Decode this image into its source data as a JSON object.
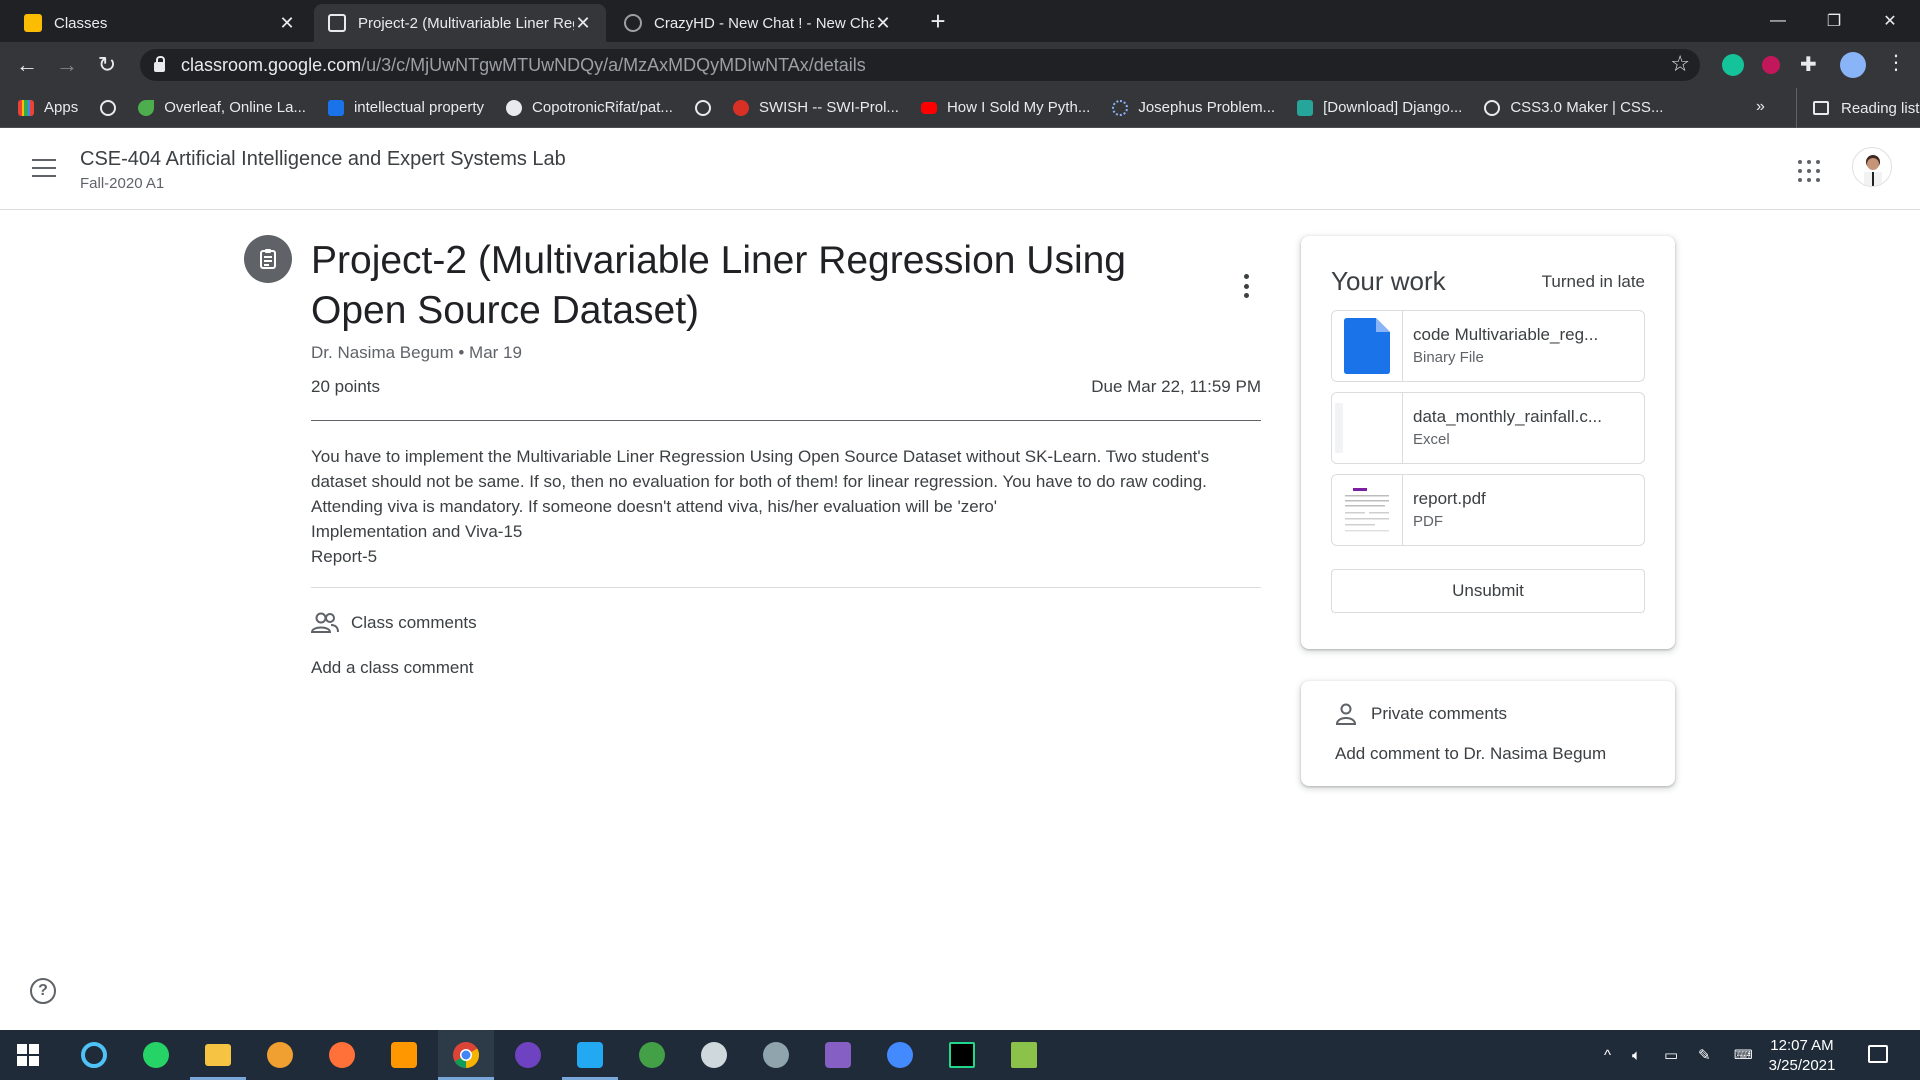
{
  "browser": {
    "tabs": [
      {
        "title": "Classes",
        "active": false
      },
      {
        "title": "Project-2 (Multivariable Liner Reg",
        "active": true
      },
      {
        "title": "CrazyHD - New Chat ! - New Cha",
        "active": false
      }
    ],
    "url_host": "classroom.google.com",
    "url_path": "/u/3/c/MjUwNTgwMTUwNDQy/a/MzAxMDQyMDIwNTAx/details",
    "bookmarks": [
      "Apps",
      "",
      "Overleaf, Online La...",
      "intellectual property",
      "CopotronicRifat/pat...",
      "",
      "SWISH -- SWI-Prol...",
      "How I Sold My Pyth...",
      "Josephus Problem...",
      "[Download] Django...",
      "CSS3.0 Maker | CSS..."
    ],
    "bookmarks_more": "»",
    "reading_list": "Reading list"
  },
  "classroom": {
    "course_title": "CSE-404 Artificial Intelligence and Expert Systems Lab",
    "course_section": "Fall-2020 A1"
  },
  "assignment": {
    "title": "Project-2 (Multivariable Liner Regression Using Open Source Dataset)",
    "author_date": "Dr. Nasima Begum • Mar 19",
    "points": "20 points",
    "due": "Due Mar 22, 11:59 PM",
    "description": [
      "You have to implement the Multivariable Liner Regression Using Open Source Dataset without SK-Learn. Two student's dataset should not be same. If so, then no evaluation for both of them! for linear regression. You have to do raw coding. Attending viva is mandatory. If someone doesn't attend viva, his/her evaluation will be 'zero'",
      "Implementation and Viva-15",
      "Report-5"
    ],
    "class_comments_label": "Class comments",
    "add_class_comment": "Add a class comment"
  },
  "your_work": {
    "title": "Your work",
    "status": "Turned in late",
    "attachments": [
      {
        "name": "code Multivariable_reg...",
        "type": "Binary File"
      },
      {
        "name": "data_monthly_rainfall.c...",
        "type": "Excel"
      },
      {
        "name": "report.pdf",
        "type": "PDF"
      }
    ],
    "unsubmit_label": "Unsubmit"
  },
  "private_comments": {
    "title": "Private comments",
    "add_label": "Add comment to Dr. Nasima Begum"
  },
  "taskbar": {
    "time": "12:07 AM",
    "date": "3/25/2021"
  },
  "colors": {
    "chrome_dark": "#202124",
    "chrome_toolbar": "#35363a",
    "file_blue": "#1a73e8",
    "taskbar": "#1f2b38"
  }
}
